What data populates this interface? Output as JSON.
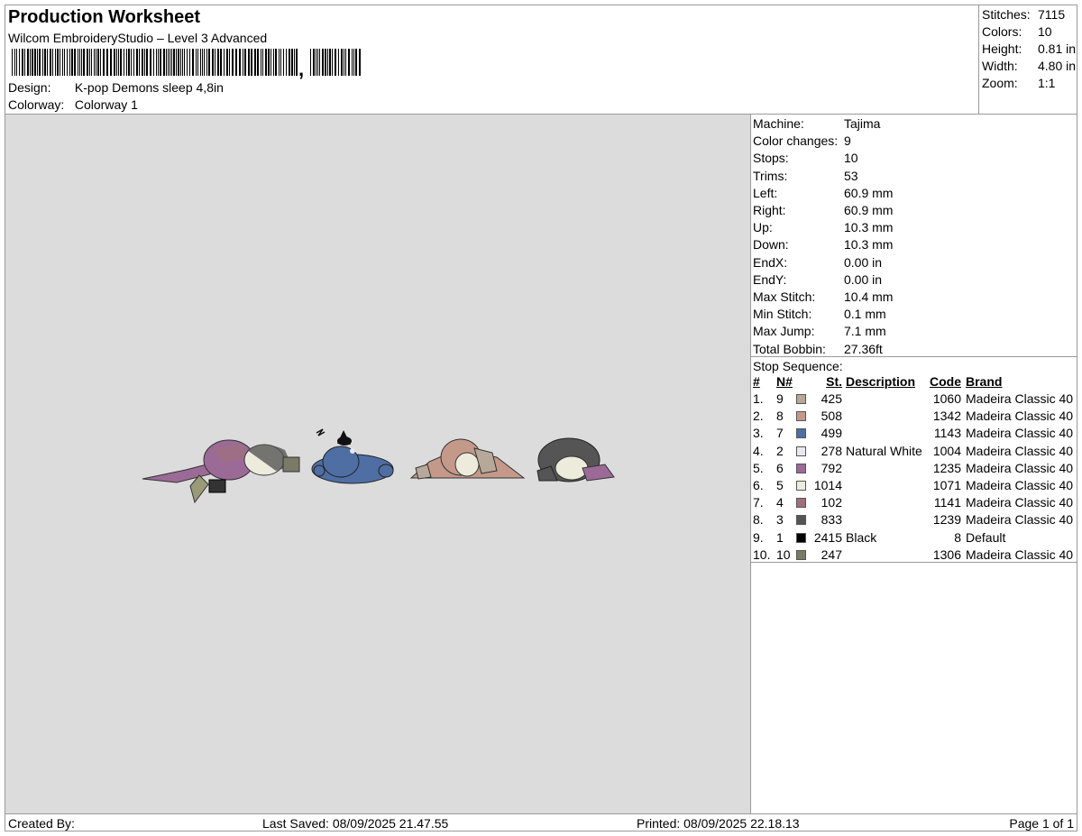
{
  "header": {
    "title": "Production Worksheet",
    "subtitle": "Wilcom EmbroideryStudio – Level 3 Advanced",
    "barcode_suffix": ",",
    "design_label": "Design:",
    "design_value": "K-pop Demons sleep 4,8in",
    "colorway_label": "Colorway:",
    "colorway_value": "Colorway 1"
  },
  "summary": {
    "stitches_label": "Stitches:",
    "stitches": "7115",
    "colors_label": "Colors:",
    "colors": "10",
    "height_label": "Height:",
    "height": "0.81 in",
    "width_label": "Width:",
    "width": "4.80 in",
    "zoom_label": "Zoom:",
    "zoom": "1:1"
  },
  "info": [
    {
      "label": "Machine:",
      "value": "Tajima"
    },
    {
      "label": "Color changes:",
      "value": "9"
    },
    {
      "label": "Stops:",
      "value": "10"
    },
    {
      "label": "Trims:",
      "value": "53"
    },
    {
      "label": "Left:",
      "value": "60.9 mm"
    },
    {
      "label": "Right:",
      "value": "60.9 mm"
    },
    {
      "label": "Up:",
      "value": "10.3 mm"
    },
    {
      "label": "Down:",
      "value": "10.3 mm"
    },
    {
      "label": "EndX:",
      "value": "0.00 in"
    },
    {
      "label": "EndY:",
      "value": "0.00 in"
    },
    {
      "label": "Max Stitch:",
      "value": "10.4 mm"
    },
    {
      "label": "Min Stitch:",
      "value": "0.1 mm"
    },
    {
      "label": "Max Jump:",
      "value": "7.1 mm"
    },
    {
      "label": "Total Bobbin:",
      "value": "27.36ft"
    }
  ],
  "stop_sequence": {
    "title": "Stop Sequence:",
    "headers": {
      "idx": "#",
      "n": "N#",
      "st": "St.",
      "desc": "Description",
      "code": "Code",
      "brand": "Brand"
    },
    "rows": [
      {
        "idx": "1.",
        "n": "9",
        "color": "#b8a89a",
        "st": "425",
        "desc": "",
        "code": "1060",
        "brand": "Madeira Classic 40"
      },
      {
        "idx": "2.",
        "n": "8",
        "color": "#c4998a",
        "st": "508",
        "desc": "",
        "code": "1342",
        "brand": "Madeira Classic 40"
      },
      {
        "idx": "3.",
        "n": "7",
        "color": "#4e6ea4",
        "st": "499",
        "desc": "",
        "code": "1143",
        "brand": "Madeira Classic 40"
      },
      {
        "idx": "4.",
        "n": "2",
        "color": "#e8e8f0",
        "st": "278",
        "desc": "Natural White",
        "code": "1004",
        "brand": "Madeira Classic 40"
      },
      {
        "idx": "5.",
        "n": "6",
        "color": "#9c6a96",
        "st": "792",
        "desc": "",
        "code": "1235",
        "brand": "Madeira Classic 40"
      },
      {
        "idx": "6.",
        "n": "5",
        "color": "#ecebdc",
        "st": "1014",
        "desc": "",
        "code": "1071",
        "brand": "Madeira Classic 40"
      },
      {
        "idx": "7.",
        "n": "4",
        "color": "#a0707c",
        "st": "102",
        "desc": "",
        "code": "1141",
        "brand": "Madeira Classic 40"
      },
      {
        "idx": "8.",
        "n": "3",
        "color": "#555555",
        "st": "833",
        "desc": "",
        "code": "1239",
        "brand": "Madeira Classic 40"
      },
      {
        "idx": "9.",
        "n": "1",
        "color": "#000000",
        "st": "2415",
        "desc": "Black",
        "code": "8",
        "brand": "Default"
      },
      {
        "idx": "10.",
        "n": "10",
        "color": "#7a7a66",
        "st": "247",
        "desc": "",
        "code": "1306",
        "brand": "Madeira Classic 40"
      }
    ]
  },
  "footer": {
    "created_by": "Created By:",
    "last_saved": "Last Saved: 08/09/2025 21.47.55",
    "printed": "Printed: 08/09/2025 22.18.13",
    "page": "Page 1 of 1"
  }
}
